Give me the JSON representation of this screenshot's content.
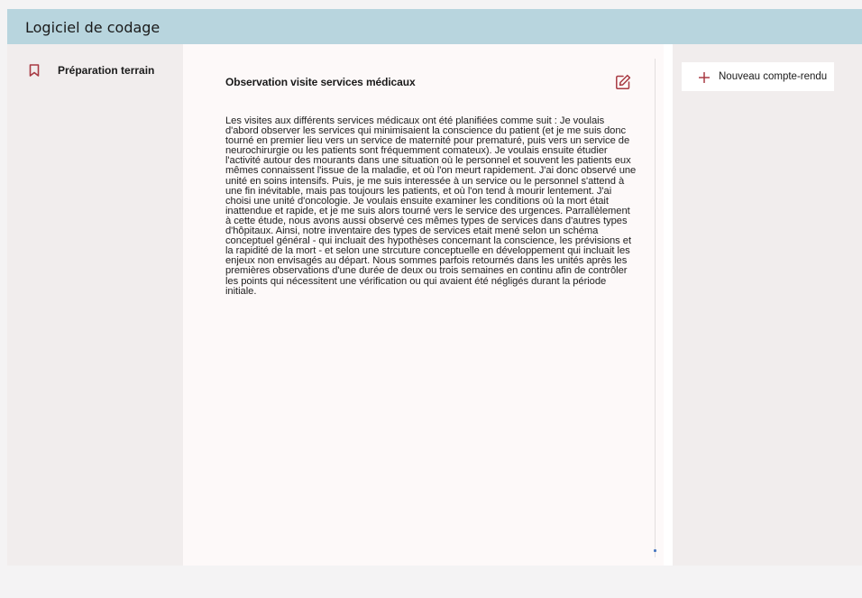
{
  "header": {
    "title": "Logiciel de codage"
  },
  "sidebar": {
    "items": [
      {
        "label": "Préparation terrain",
        "icon": "bookmark-icon"
      }
    ]
  },
  "document": {
    "title": "Observation visite services médicaux",
    "edit_icon": "edit-icon",
    "body": "Les visites aux différents services médicaux ont été planifiées comme suit : Je voulais d'abord observer les services qui minimisaient la conscience du patient (et je me suis donc tourné en premier lieu vers un service de maternité pour prematuré, puis vers un service de neurochirurgie ou les patients sont fréquemment comateux). Je voulais ensuite  étudier l'activité autour des mourants dans une situation où le personnel et souvent les patients eux mêmes connaissent l'issue de la maladie, et où l'on meurt rapidement. J'ai  donc observé une unité en soins intensifs. Puis, je me suis interessée à un service ou le personnel s'attend à une fin inévitable, mais pas toujours les patients, et où l'on tend à mourir lentement. J'ai choisi une unité d'oncologie. Je voulais  ensuite  examiner les conditions où la mort était inattendue et rapide, et je me suis alors tourné vers le service des urgences. Parrallèlement à cette étude, nous avons aussi observé ces mêmes types de services dans d'autres types d'hôpitaux. Ainsi, notre inventaire  des types de services etait mené selon  un schéma conceptuel général - qui incluait des hypothèses  concernant la conscience, les prévisions et la rapidité de la mort - et selon une strcuture conceptuelle en développement qui incluait les enjeux non envisagés au départ. Nous sommes parfois retournés dans les unités après les premières observations d'une durée de deux ou trois semaines en continu afin de contrôler les points qui nécessitent une vérification ou qui avaient été négligés durant la période initiale."
  },
  "rightbar": {
    "new_report_label": "Nouveau compte-rendu",
    "new_report_icon": "plus-icon"
  },
  "colors": {
    "header_bg": "#b8d5de",
    "panel_bg": "#f1eded",
    "document_bg": "#fdf9f9",
    "accent": "#a83a43",
    "scroll_thumb": "#4a78c0"
  }
}
